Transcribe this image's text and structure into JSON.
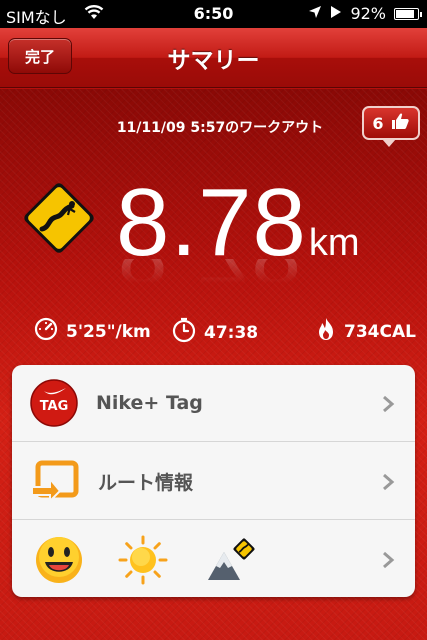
{
  "status_bar": {
    "carrier": "SIMなし",
    "time": "6:50",
    "battery": "92%",
    "battery_level": 0.92
  },
  "nav": {
    "done_label": "完了",
    "title": "サマリー"
  },
  "summary": {
    "workout_date": "11/11/09 5:57のワークアウト",
    "cheer_count": "6",
    "distance": "8.78",
    "distance_unit": "km",
    "pace": "5'25\"/km",
    "duration": "47:38",
    "calories": "734CAL"
  },
  "menu": {
    "tag_icon_text": "TAG",
    "nike_tag_label": "Nike+ Tag",
    "route_label": "ルート情報"
  },
  "colors": {
    "accent_red": "#c21b15",
    "sign_yellow": "#f6c400"
  }
}
